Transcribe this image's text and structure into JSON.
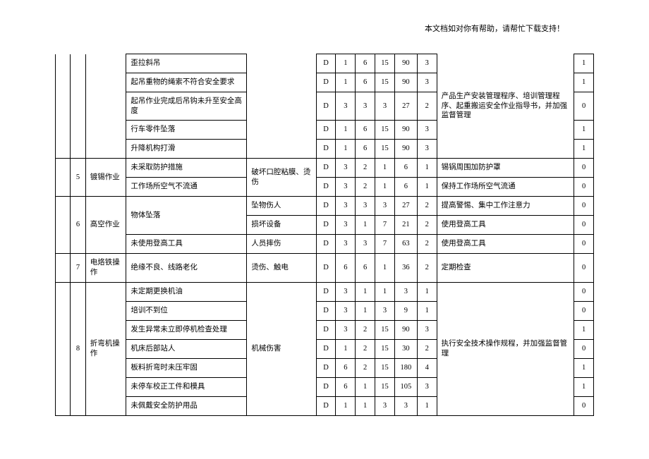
{
  "header_note": "本文档如对你有帮助，请帮忙下载支持！",
  "rows": [
    {
      "idx": "",
      "num": "",
      "act": "",
      "cause": "歪拉斜吊",
      "cons": "",
      "d": "D",
      "v1": "1",
      "v2": "6",
      "v3": "15",
      "v4": "90",
      "v5": "3",
      "meas": "",
      "last": "1"
    },
    {
      "idx": "",
      "num": "",
      "act": "",
      "cause": "起吊重物的绳索不符合安全要求",
      "cons": "",
      "d": "D",
      "v1": "1",
      "v2": "6",
      "v3": "15",
      "v4": "90",
      "v5": "3",
      "meas": "",
      "last": "1"
    },
    {
      "idx": "",
      "num": "",
      "act": "",
      "cause": "起吊作业完成后吊钩未升至安全高度",
      "cons": "",
      "d": "D",
      "v1": "3",
      "v2": "3",
      "v3": "3",
      "v4": "27",
      "v5": "2",
      "meas": "",
      "last": "0"
    },
    {
      "idx": "",
      "num": "",
      "act": "",
      "cause": "行车零件坠落",
      "cons": "",
      "d": "D",
      "v1": "1",
      "v2": "6",
      "v3": "15",
      "v4": "90",
      "v5": "3",
      "meas": "",
      "last": "1"
    },
    {
      "idx": "",
      "num": "",
      "act": "",
      "cause": "升降机构打滑",
      "cons": "",
      "d": "D",
      "v1": "1",
      "v2": "6",
      "v3": "15",
      "v4": "90",
      "v5": "3",
      "meas": "",
      "last": "1"
    },
    {
      "idx": "",
      "num": "5",
      "act": "镀锡作业",
      "cause": "未采取防护措施",
      "cons": "破坏口腔粘膜、烫伤",
      "d": "D",
      "v1": "3",
      "v2": "2",
      "v3": "1",
      "v4": "6",
      "v5": "1",
      "meas": "锡锅周围加防护罩",
      "last": "0"
    },
    {
      "idx": "",
      "num": "",
      "act": "",
      "cause": "工作场所空气不流通",
      "cons": "",
      "d": "D",
      "v1": "3",
      "v2": "2",
      "v3": "1",
      "v4": "6",
      "v5": "1",
      "meas": "保持工作场所空气流通",
      "last": "0"
    },
    {
      "idx": "",
      "num": "6",
      "act": "高空作业",
      "cause": "物体坠落",
      "cons": "坠物伤人",
      "d": "D",
      "v1": "3",
      "v2": "3",
      "v3": "3",
      "v4": "27",
      "v5": "2",
      "meas": "提高警惕、集中工作注意力",
      "last": "0"
    },
    {
      "idx": "",
      "num": "",
      "act": "",
      "cause": "",
      "cons": "损坏设备",
      "d": "D",
      "v1": "3",
      "v2": "1",
      "v3": "7",
      "v4": "21",
      "v5": "2",
      "meas": "使用登高工具",
      "last": "0"
    },
    {
      "idx": "",
      "num": "",
      "act": "",
      "cause": "未使用登高工具",
      "cons": "人员摔伤",
      "d": "D",
      "v1": "3",
      "v2": "3",
      "v3": "7",
      "v4": "63",
      "v5": "2",
      "meas": "使用登高工具",
      "last": "0"
    },
    {
      "idx": "",
      "num": "7",
      "act": "电烙铁操作",
      "cause": "绝缘不良、线路老化",
      "cons": "烫伤、触电",
      "d": "D",
      "v1": "6",
      "v2": "6",
      "v3": "1",
      "v4": "36",
      "v5": "2",
      "meas": "定期检查",
      "last": "0"
    },
    {
      "idx": "",
      "num": "8",
      "act": "折弯机操作",
      "cause": "未定期更换机油",
      "cons": "机械伤害",
      "d": "D",
      "v1": "3",
      "v2": "1",
      "v3": "1",
      "v4": "3",
      "v5": "1",
      "meas": "执行安全技术操作规程，并加强监督管理",
      "last": "0"
    },
    {
      "idx": "",
      "num": "",
      "act": "",
      "cause": "培训不到位",
      "cons": "",
      "d": "D",
      "v1": "3",
      "v2": "1",
      "v3": "3",
      "v4": "9",
      "v5": "1",
      "meas": "",
      "last": "0"
    },
    {
      "idx": "",
      "num": "",
      "act": "",
      "cause": "发生异常未立即停机检查处理",
      "cons": "",
      "d": "D",
      "v1": "3",
      "v2": "2",
      "v3": "15",
      "v4": "90",
      "v5": "3",
      "meas": "",
      "last": "1"
    },
    {
      "idx": "",
      "num": "",
      "act": "",
      "cause": "机床后部站人",
      "cons": "",
      "d": "D",
      "v1": "1",
      "v2": "2",
      "v3": "15",
      "v4": "30",
      "v5": "2",
      "meas": "",
      "last": "0"
    },
    {
      "idx": "",
      "num": "",
      "act": "",
      "cause": "板料折弯时未压牢固",
      "cons": "",
      "d": "D",
      "v1": "6",
      "v2": "2",
      "v3": "15",
      "v4": "180",
      "v5": "4",
      "meas": "",
      "last": "1"
    },
    {
      "idx": "",
      "num": "",
      "act": "",
      "cause": "未停车校正工件和模具",
      "cons": "",
      "d": "D",
      "v1": "6",
      "v2": "1",
      "v3": "15",
      "v4": "105",
      "v5": "3",
      "meas": "",
      "last": "1"
    },
    {
      "idx": "",
      "num": "",
      "act": "",
      "cause": "未佩戴安全防护用品",
      "cons": "",
      "d": "D",
      "v1": "1",
      "v2": "1",
      "v3": "3",
      "v4": "3",
      "v5": "1",
      "meas": "",
      "last": "0"
    }
  ],
  "group_top": {
    "meas": "产品生产安装管理程序、培训管理程序、起重搬运安全作业指导书，并加强监督管理"
  }
}
